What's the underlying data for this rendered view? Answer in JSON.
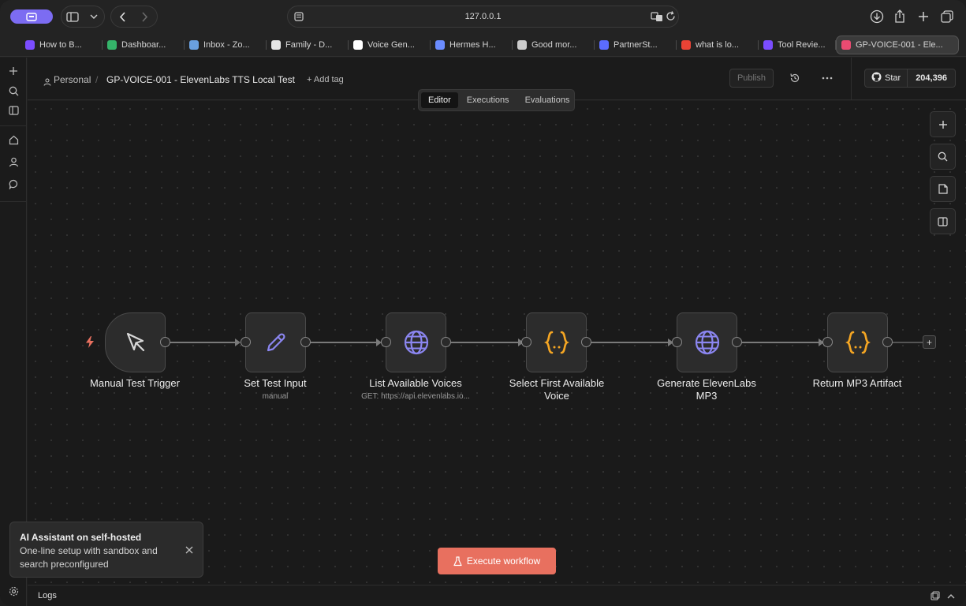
{
  "browser": {
    "url": "127.0.0.1",
    "accent_color": "#7c6cf2",
    "tabs": [
      {
        "label": "How to B...",
        "icon": "p-logo-icon",
        "color": "#7b4dff"
      },
      {
        "label": "Dashboar...",
        "icon": "chat-bubble-icon",
        "color": "#35b46a"
      },
      {
        "label": "Inbox - Zo...",
        "icon": "mail-icon",
        "color": "#6aa0e0"
      },
      {
        "label": "Family - D...",
        "icon": "doc-icon",
        "color": "#e6e6e6"
      },
      {
        "label": "Voice Gen...",
        "icon": "pause-icon",
        "color": "#ffffff"
      },
      {
        "label": "Hermes H...",
        "icon": "sparkle-icon",
        "color": "#6b8cff"
      },
      {
        "label": "Good mor...",
        "icon": "instagram-icon",
        "color": "#cccccc"
      },
      {
        "label": "PartnerSt...",
        "icon": "partner-icon",
        "color": "#5b6cff"
      },
      {
        "label": "what is lo...",
        "icon": "google-icon",
        "color": "#ea4335"
      },
      {
        "label": "Tool Revie...",
        "icon": "p-logo-icon",
        "color": "#7b4dff"
      },
      {
        "label": "GP-VOICE-001 - Ele...",
        "icon": "n8n-icon",
        "color": "#ea4b71"
      }
    ]
  },
  "header": {
    "breadcrumb_project": "Personal",
    "separator": "/",
    "workflow_title": "GP-VOICE-001 - ElevenLabs TTS Local Test",
    "add_tag": "+ Add tag",
    "publish": "Publish",
    "star_label": "Star",
    "star_count": "204,396"
  },
  "view_tabs": [
    "Editor",
    "Executions",
    "Evaluations"
  ],
  "active_view_tab": "Editor",
  "nodes": [
    {
      "label": "Manual Test Trigger",
      "sub": "",
      "icon": "cursor-icon"
    },
    {
      "label": "Set Test Input",
      "sub": "manual",
      "icon": "pencil-icon"
    },
    {
      "label": "List Available Voices",
      "sub": "GET: https://api.elevenlabs.io...",
      "icon": "globe-icon"
    },
    {
      "label": "Select First Available Voice",
      "sub": "",
      "icon": "code-braces-icon"
    },
    {
      "label": "Generate ElevenLabs MP3",
      "sub": "",
      "icon": "globe-icon"
    },
    {
      "label": "Return MP3 Artifact",
      "sub": "",
      "icon": "code-braces-icon"
    }
  ],
  "colors": {
    "http_icon": "#8b86f0",
    "code_icon": "#f5a623",
    "trigger_bolt": "#e8705f",
    "execute_button": "#e8705f"
  },
  "execute_button": "Execute workflow",
  "toast": {
    "title": "AI Assistant on self-hosted",
    "body": "One-line setup with sandbox and search preconfigured"
  },
  "logs_label": "Logs"
}
